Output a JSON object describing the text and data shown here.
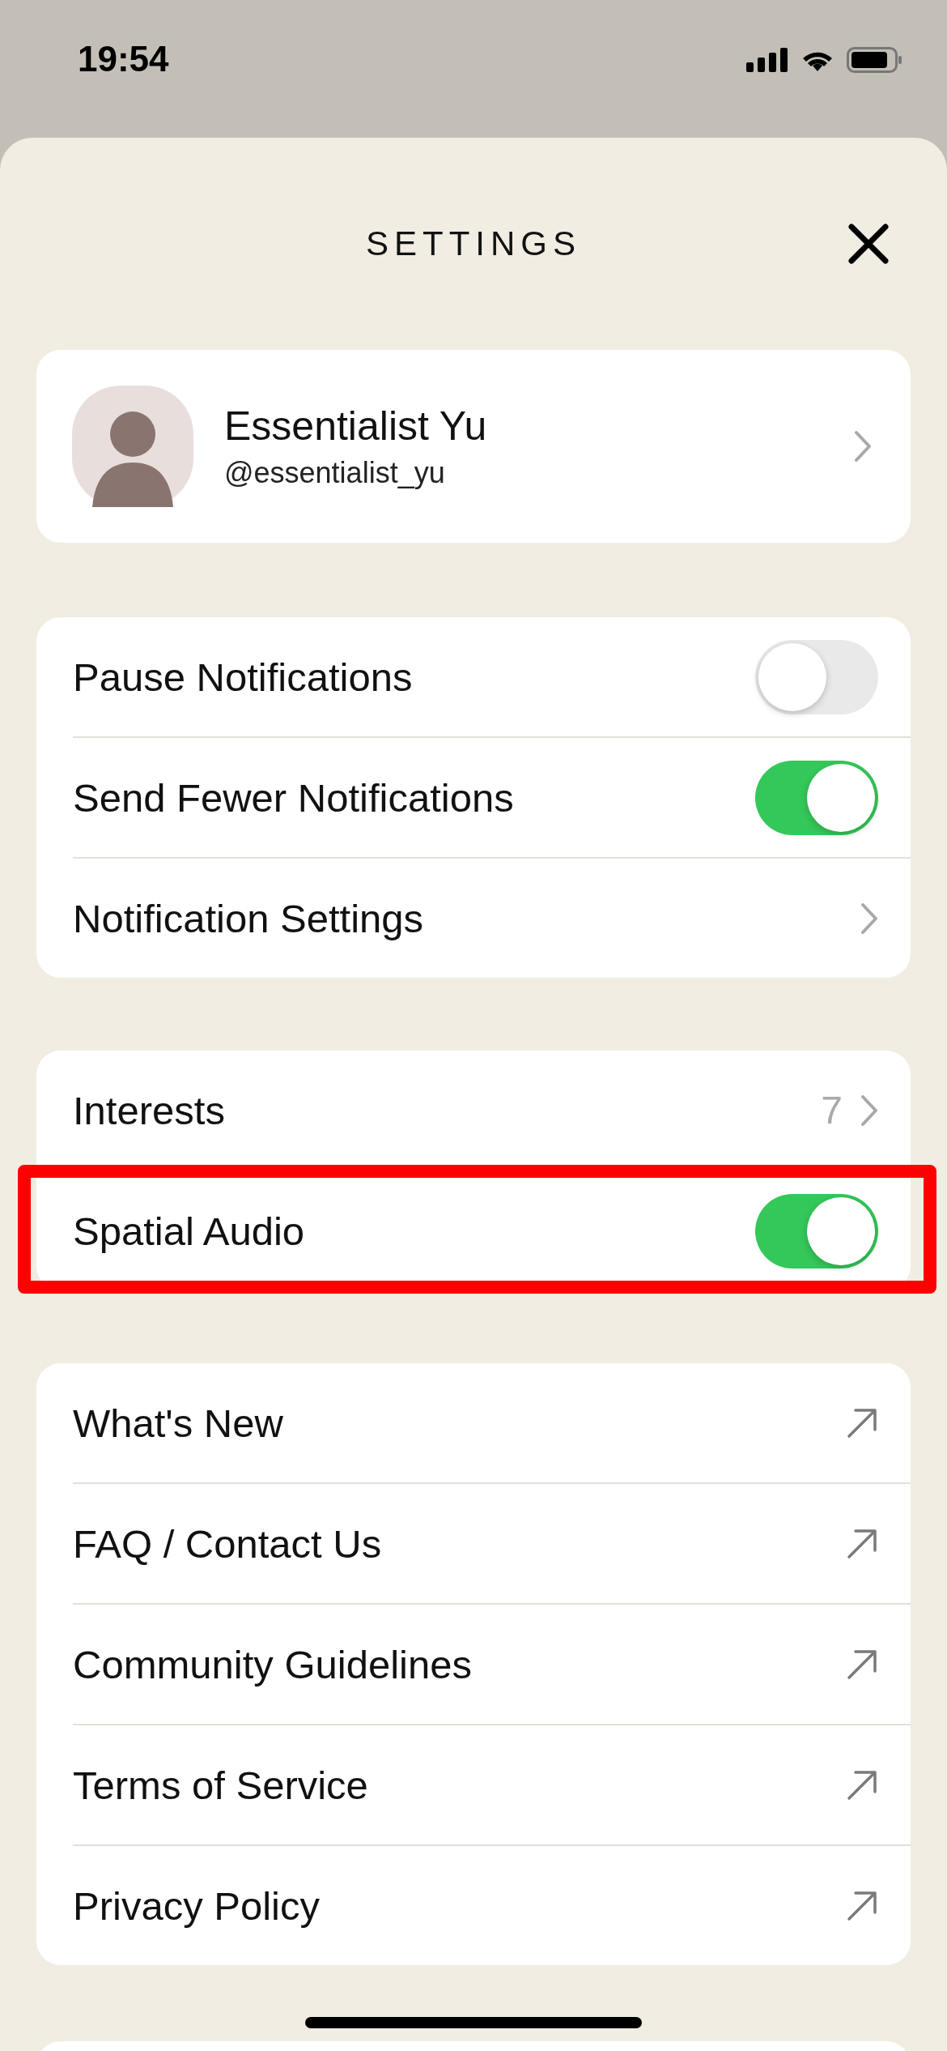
{
  "status_bar": {
    "time": "19:54"
  },
  "header": {
    "title": "SETTINGS"
  },
  "profile": {
    "name": "Essentialist Yu",
    "handle": "@essentialist_yu"
  },
  "groups": [
    {
      "rows": [
        {
          "kind": "toggle",
          "label": "Pause Notifications",
          "on": false,
          "highlighted": false
        },
        {
          "kind": "toggle",
          "label": "Send Fewer Notifications",
          "on": true,
          "highlighted": false
        },
        {
          "kind": "link",
          "label": "Notification Settings",
          "highlighted": false
        }
      ]
    },
    {
      "rows": [
        {
          "kind": "link",
          "label": "Interests",
          "value": "7",
          "highlighted": false
        },
        {
          "kind": "toggle",
          "label": "Spatial Audio",
          "on": true,
          "highlighted": true
        }
      ]
    },
    {
      "rows": [
        {
          "kind": "external",
          "label": "What's New",
          "highlighted": false
        },
        {
          "kind": "external",
          "label": "FAQ / Contact Us",
          "highlighted": false
        },
        {
          "kind": "external",
          "label": "Community Guidelines",
          "highlighted": false
        },
        {
          "kind": "external",
          "label": "Terms of Service",
          "highlighted": false
        },
        {
          "kind": "external",
          "label": "Privacy Policy",
          "highlighted": false
        }
      ]
    }
  ]
}
